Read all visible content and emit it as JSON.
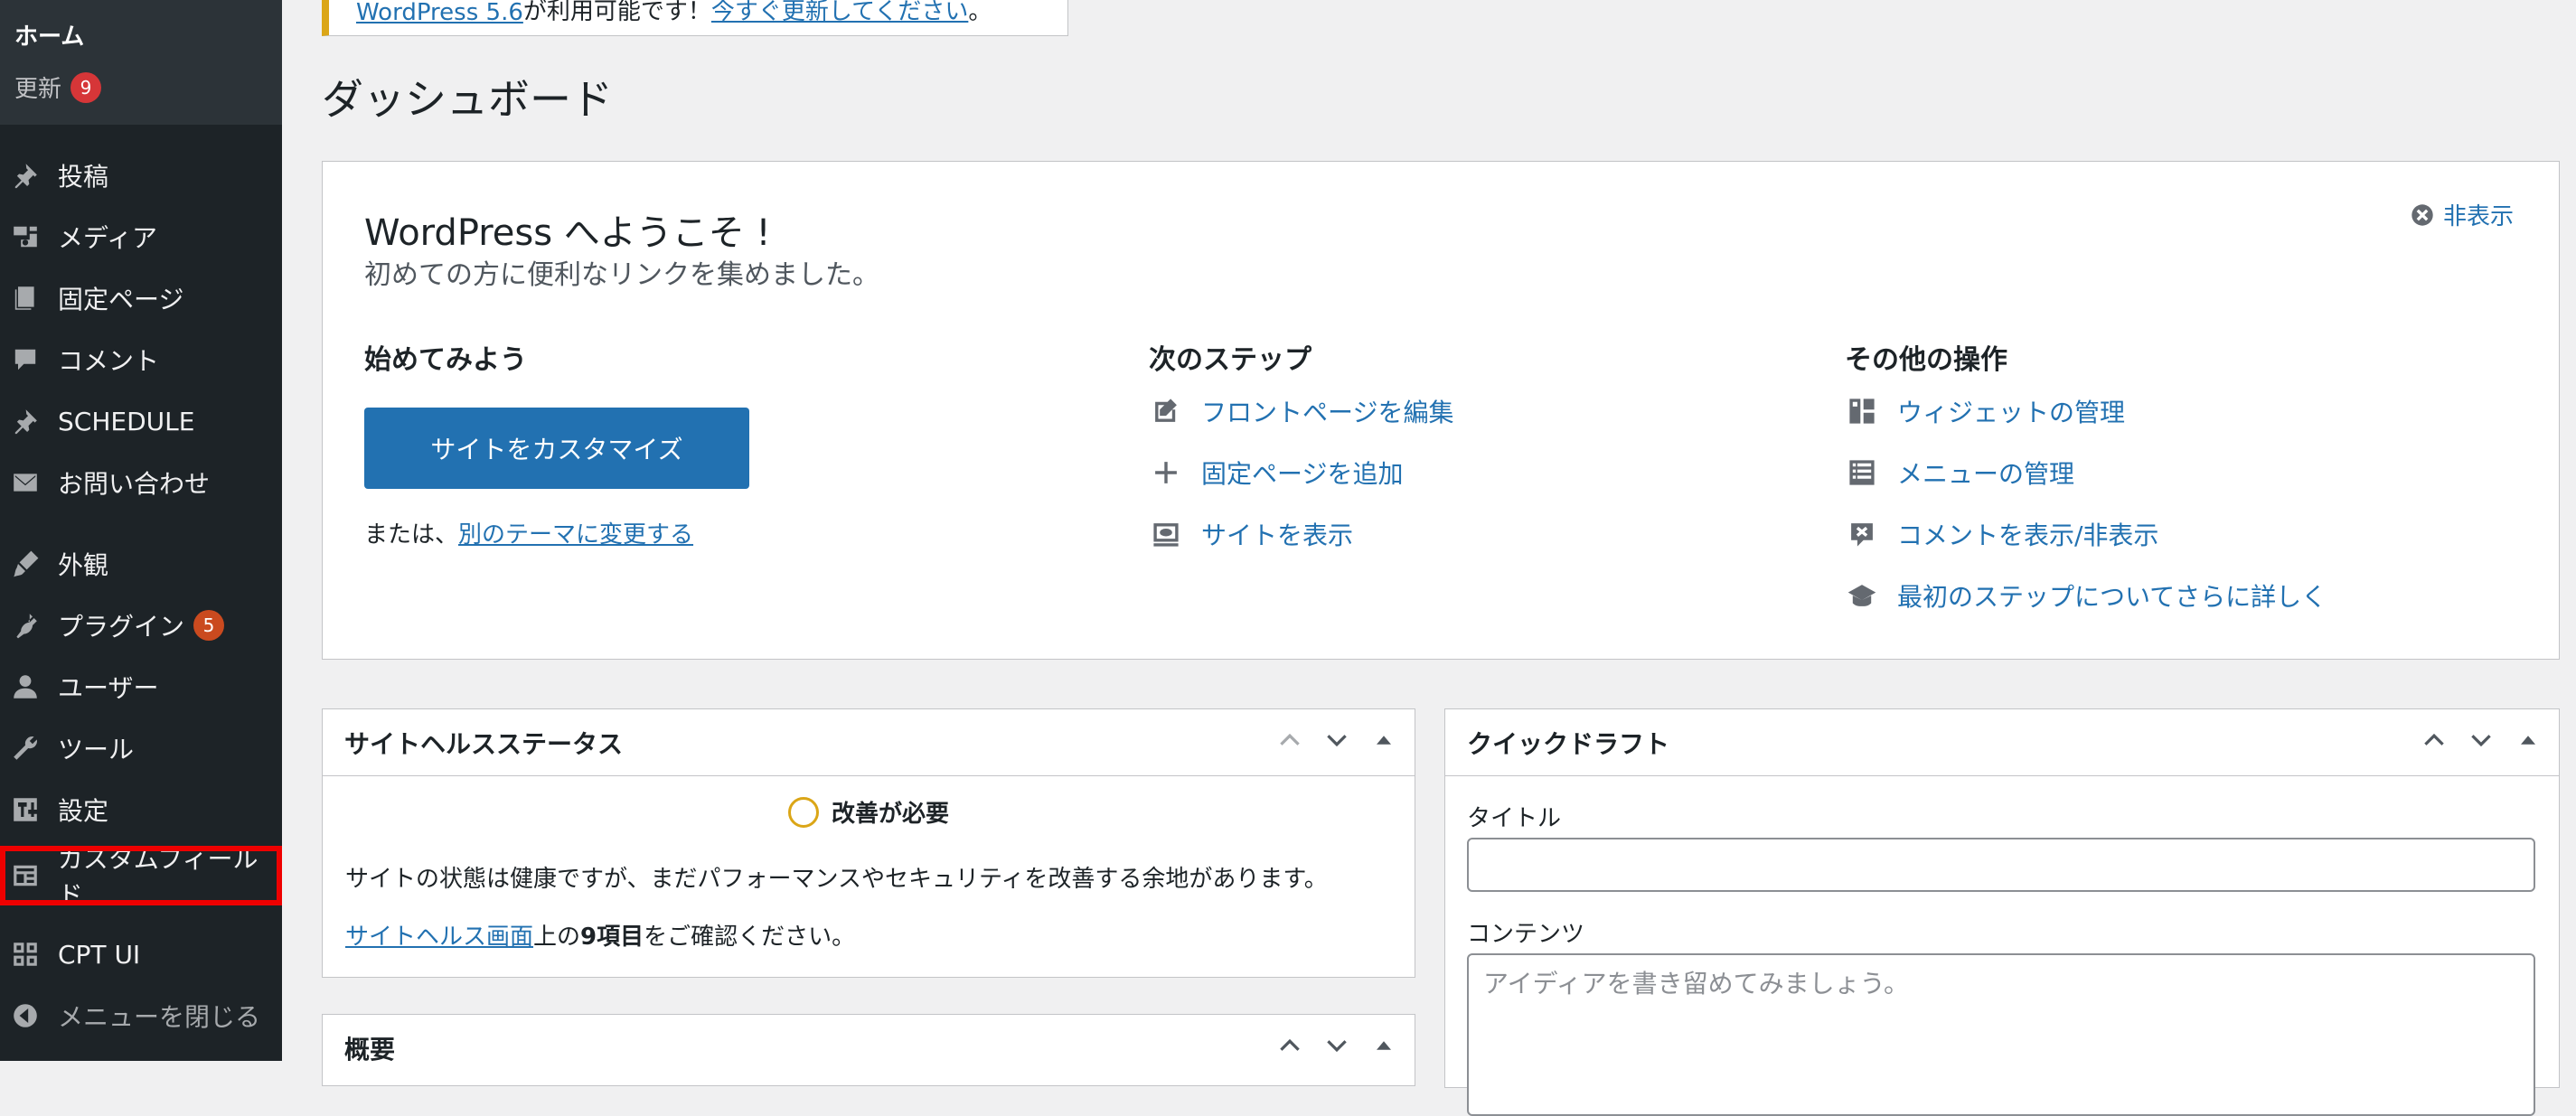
{
  "sidebar": {
    "home": "ホーム",
    "update": "更新",
    "update_count": "9",
    "items": [
      {
        "label": "投稿",
        "icon": "pin-icon"
      },
      {
        "label": "メディア",
        "icon": "media-icon"
      },
      {
        "label": "固定ページ",
        "icon": "page-icon"
      },
      {
        "label": "コメント",
        "icon": "comment-icon"
      },
      {
        "label": "SCHEDULE",
        "icon": "pin-icon"
      },
      {
        "label": "お問い合わせ",
        "icon": "mail-icon"
      },
      {
        "label": "外観",
        "icon": "brush-icon"
      },
      {
        "label": "プラグイン",
        "icon": "plugin-icon",
        "badge": "5"
      },
      {
        "label": "ユーザー",
        "icon": "user-icon"
      },
      {
        "label": "ツール",
        "icon": "wrench-icon"
      },
      {
        "label": "設定",
        "icon": "settings-icon"
      },
      {
        "label": "カスタムフィールド",
        "icon": "table-icon"
      },
      {
        "label": "CPT UI",
        "icon": "grid-icon"
      },
      {
        "label": "メニューを閉じる",
        "icon": "collapse-icon"
      }
    ]
  },
  "notice": {
    "link1": "WordPress 5.6",
    "text": " が利用可能です！",
    "link2": "今すぐ更新してください",
    "end": "。"
  },
  "page_title": "ダッシュボード",
  "welcome": {
    "title": "WordPress へようこそ !",
    "subtitle": "初めての方に便利なリンクを集めました。",
    "dismiss": "非表示",
    "col1": {
      "heading": "始めてみよう",
      "button": "サイトをカスタマイズ",
      "alt_prefix": "または、",
      "alt_link": "別のテーマに変更する"
    },
    "col2": {
      "heading": "次のステップ",
      "links": [
        "フロントページを編集",
        "固定ページを追加",
        "サイトを表示"
      ]
    },
    "col3": {
      "heading": "その他の操作",
      "links": [
        "ウィジェットの管理",
        "メニューの管理",
        "コメントを表示/非表示",
        "最初のステップについてさらに詳しく"
      ]
    }
  },
  "site_health": {
    "title": "サイトヘルスステータス",
    "status": "改善が必要",
    "description": "サイトの状態は健康ですが、まだパフォーマンスやセキュリティを改善する余地があります。",
    "link": "サイトヘルス画面",
    "suffix_before": "上の",
    "count": "9項目",
    "suffix_after": "をご確認ください。"
  },
  "overview": {
    "title": "概要"
  },
  "quick_draft": {
    "title": "クイックドラフト",
    "title_label": "タイトル",
    "title_value": "",
    "content_label": "コンテンツ",
    "content_placeholder": "アイディアを書き留めてみましょう。"
  },
  "colors": {
    "accent": "#2271b1",
    "sidebar": "#1d2327",
    "notice": "#dba617",
    "badge": "#d63638"
  }
}
